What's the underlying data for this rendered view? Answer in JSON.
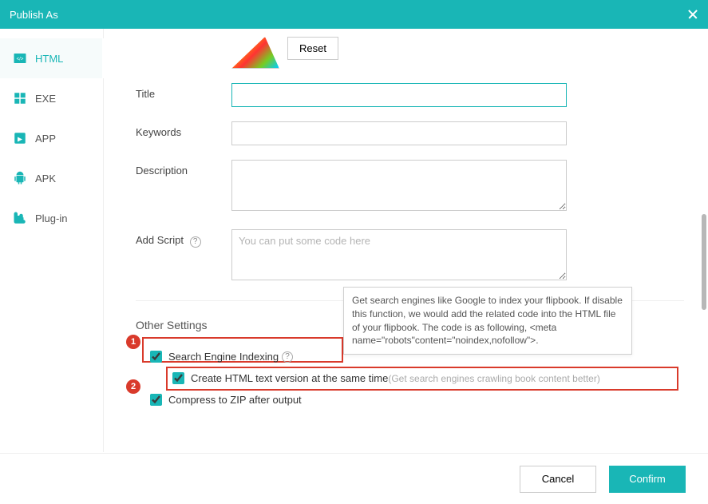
{
  "titlebar": {
    "title": "Publish As"
  },
  "sidebar": {
    "items": [
      {
        "label": "HTML"
      },
      {
        "label": "EXE"
      },
      {
        "label": "APP"
      },
      {
        "label": "APK"
      },
      {
        "label": "Plug-in"
      }
    ]
  },
  "form": {
    "reset_label": "Reset",
    "title_label": "Title",
    "title_value": "",
    "keywords_label": "Keywords",
    "keywords_value": "",
    "description_label": "Description",
    "description_value": "",
    "addscript_label": "Add Script",
    "addscript_placeholder": "You can put some code here",
    "addscript_value": ""
  },
  "other": {
    "heading": "Other Settings",
    "tooltip": " Get search engines like Google to index your flipbook. If disable this function, we would add the related code into the HTML file of your flipbook. The code is as following, <meta name=\"robots\"content=\"noindex,nofollow\">.",
    "opt1_label": "Search Engine Indexing",
    "opt2_label": "Create HTML text version at the same time",
    "opt2_hint": "(Get search engines crawling book content better)",
    "opt3_label": "Compress to ZIP after output",
    "badge1": "1",
    "badge2": "2"
  },
  "footer": {
    "cancel": "Cancel",
    "confirm": "Confirm"
  }
}
